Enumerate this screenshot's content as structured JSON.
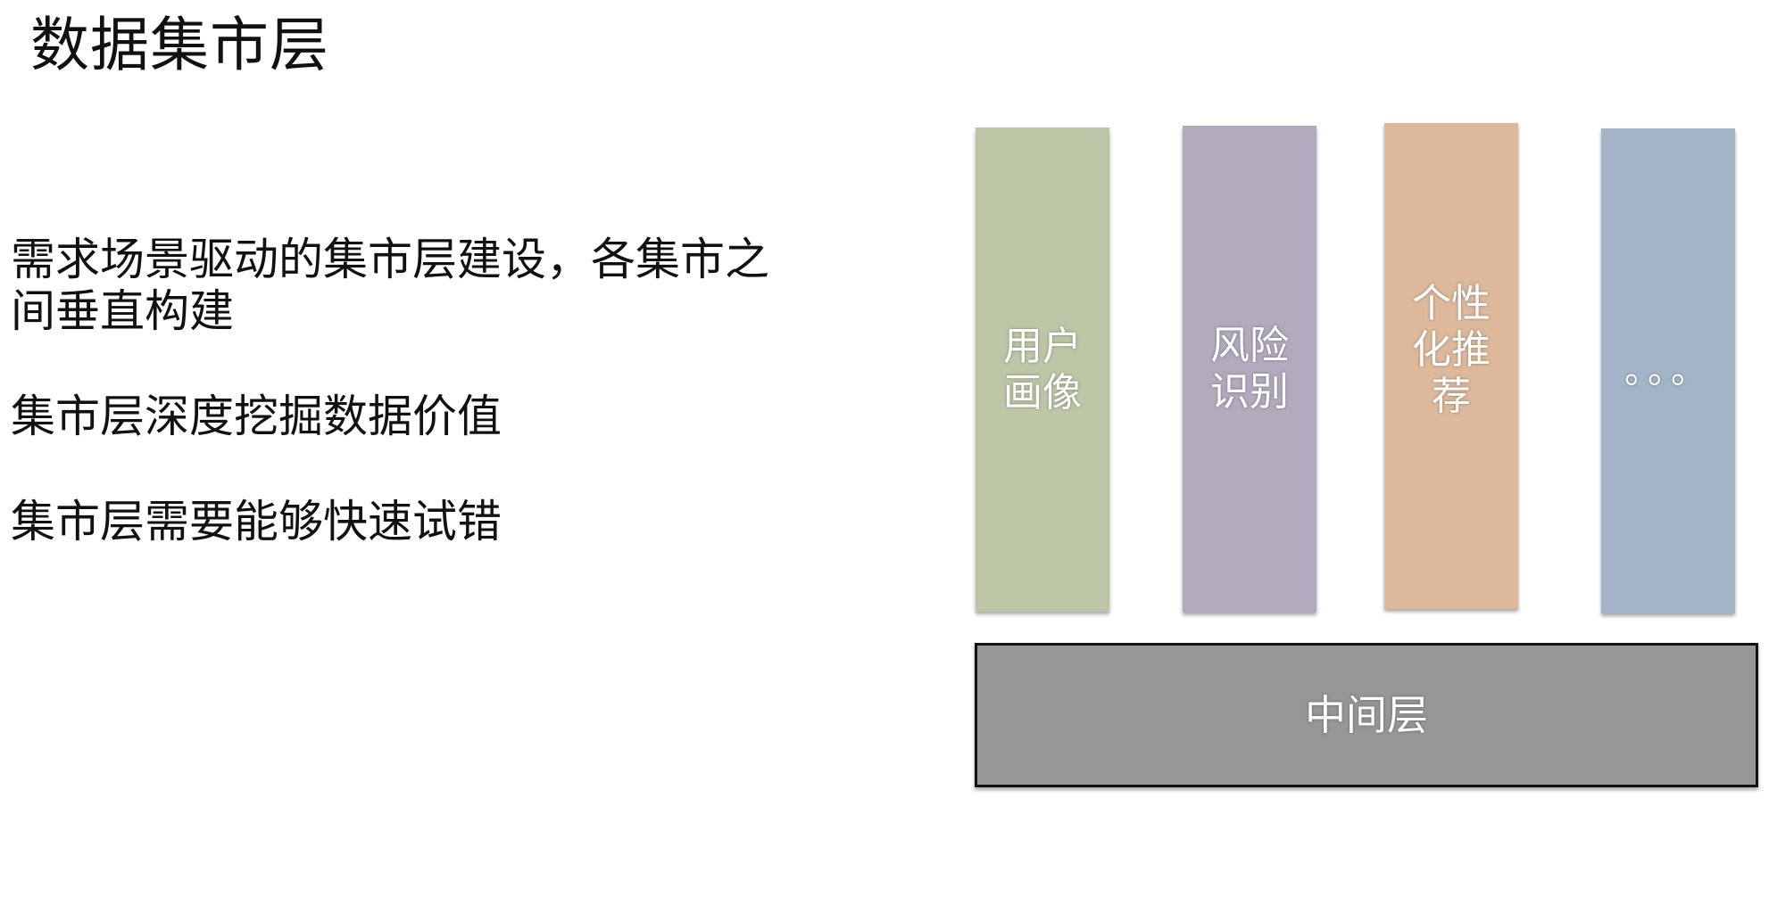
{
  "slide": {
    "title": "数据集市层"
  },
  "bullets": [
    "需求场景驱动的集市层建设，各集市之间垂直构建",
    "集市层深度挖掘数据价值",
    "集市层需要能够快速试错"
  ],
  "diagram": {
    "marts": [
      {
        "label": "用户画像",
        "color": "#bcc6a6"
      },
      {
        "label": "风险识别",
        "color": "#b2aabd"
      },
      {
        "label": "个性化推荐",
        "color": "#ddb89a"
      },
      {
        "label": "。。。",
        "color": "#a2b4c8"
      }
    ],
    "middle_layer": {
      "label": "中间层",
      "color": "#969696"
    }
  }
}
